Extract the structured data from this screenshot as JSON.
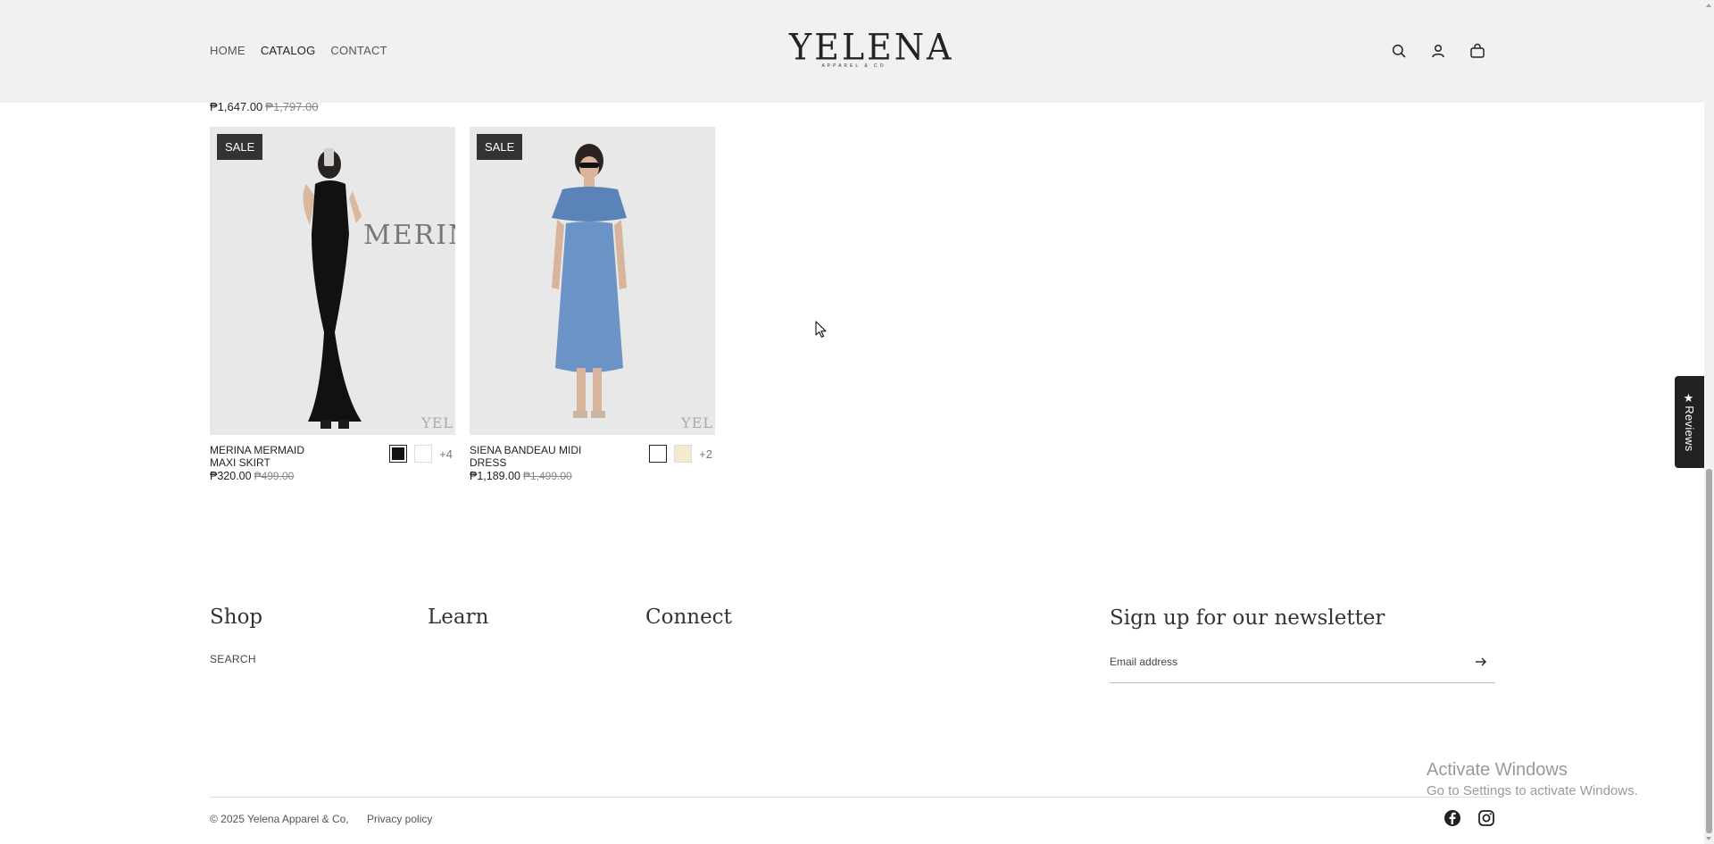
{
  "header": {
    "nav": [
      {
        "label": "HOME",
        "active": false
      },
      {
        "label": "CATALOG",
        "active": true
      },
      {
        "label": "CONTACT",
        "active": false
      }
    ],
    "logo_text": "YELENA",
    "logo_sub": "APPAREL & CO",
    "icons": [
      "search-icon",
      "account-icon",
      "cart-icon"
    ]
  },
  "prev_row": {
    "price": "₱1,647.00",
    "compare_price": "₱1,797.00"
  },
  "products": [
    {
      "badge": "SALE",
      "name": "MERINA MERMAID MAXI SKIRT",
      "price": "₱320.00",
      "compare_price": "₱499.00",
      "swatches": [
        "#111111",
        "#ffffff"
      ],
      "selected_swatch": 0,
      "more_colors": "+4",
      "image_text": "MERINA",
      "image_watermark": "YEL"
    },
    {
      "badge": "SALE",
      "name": "SIENA BANDEAU MIDI DRESS",
      "price": "₱1,189.00",
      "compare_price": "₱1,499.00",
      "swatches": [
        "#ffffff",
        "#f3ead0"
      ],
      "selected_swatch": 0,
      "more_colors": "+2",
      "image_text": "",
      "image_watermark": "YEL"
    }
  ],
  "footer": {
    "columns": [
      "Shop",
      "Learn",
      "Connect"
    ],
    "shop_links": [
      "SEARCH"
    ],
    "newsletter_title": "Sign up for our newsletter",
    "email_placeholder": "Email address",
    "copyright": "© 2025 Yelena Apparel & Co,",
    "privacy": "Privacy policy",
    "social": [
      "facebook-icon",
      "instagram-icon"
    ]
  },
  "reviews_tab": "★Reviews",
  "windows_watermark": {
    "line1": "Activate Windows",
    "line2": "Go to Settings to activate Windows."
  }
}
